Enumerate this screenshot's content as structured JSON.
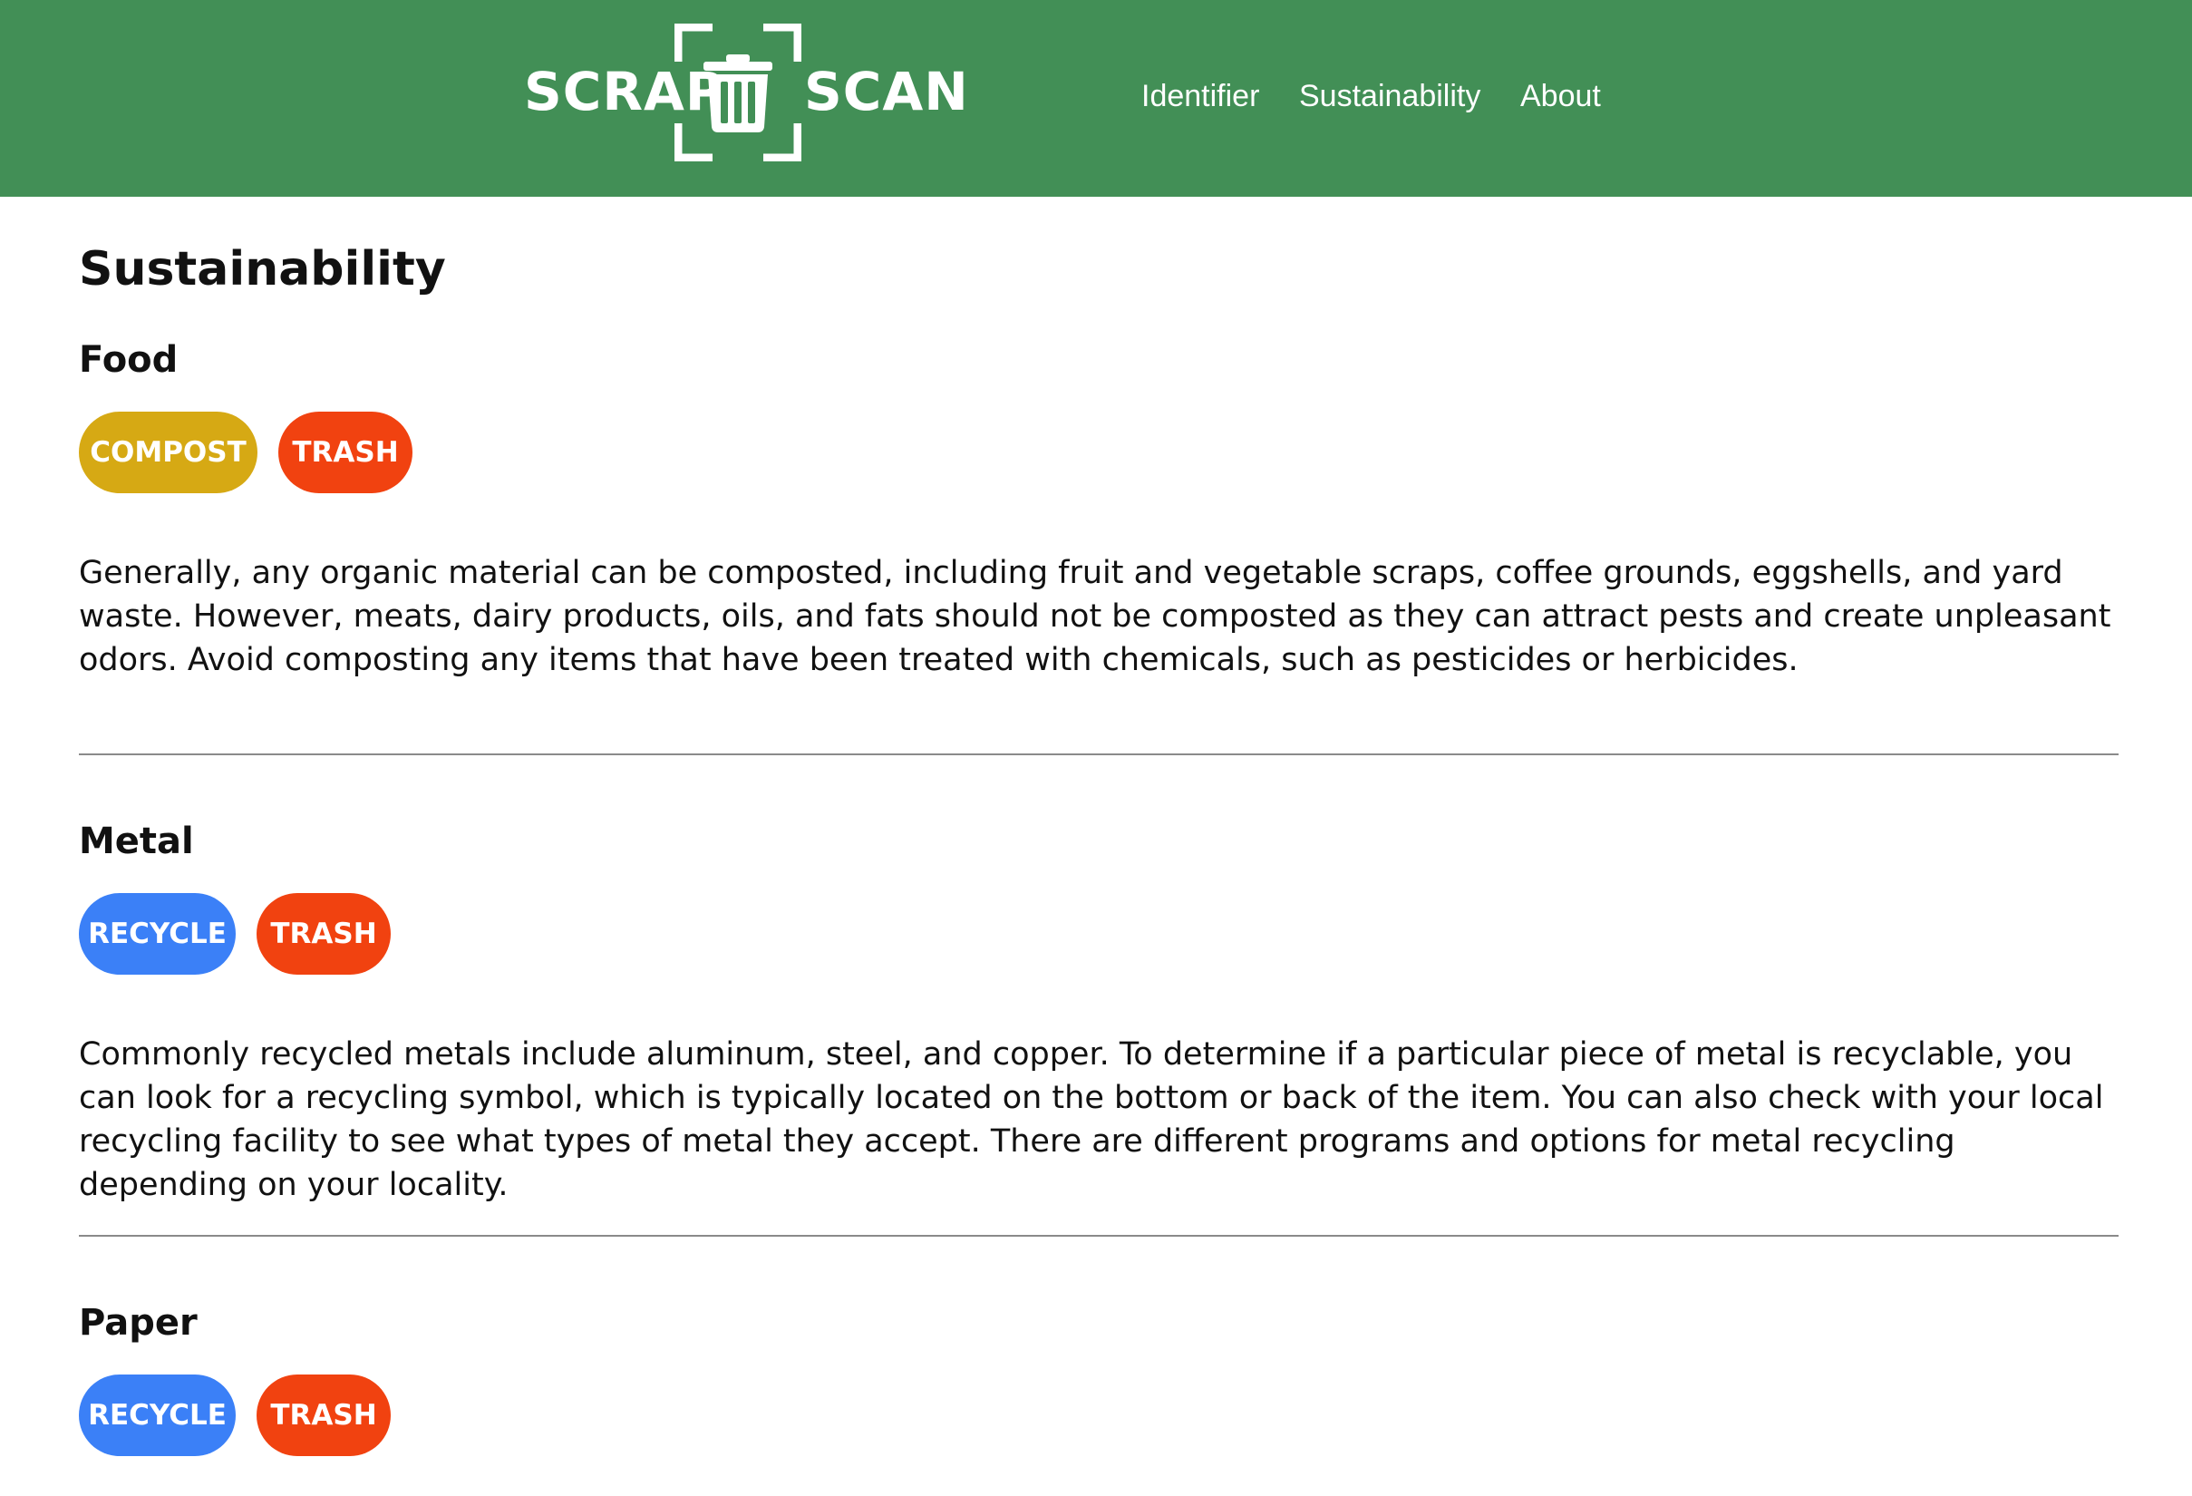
{
  "colors": {
    "header_bg": "#428f56",
    "compost": "#d6a914",
    "trash": "#f14210",
    "recycle": "#3b80f7"
  },
  "header": {
    "logo": {
      "left_word": "SCRAP",
      "right_word": "SCAN",
      "icon": "trash-can-scan-icon"
    },
    "nav": [
      "Identifier",
      "Sustainability",
      "About"
    ]
  },
  "page_title": "Sustainability",
  "sections": [
    {
      "title": "Food",
      "tags": [
        "COMPOST",
        "TRASH"
      ],
      "description": "Generally, any organic material can be composted, including fruit and vegetable scraps, coffee grounds, eggshells, and yard waste. However, meats, dairy products, oils, and fats should not be composted as they can attract pests and create unpleasant odors. Avoid composting any items that have been treated with chemicals, such as pesticides or herbicides."
    },
    {
      "title": "Metal",
      "tags": [
        "RECYCLE",
        "TRASH"
      ],
      "description": "Commonly recycled metals include aluminum, steel, and copper. To determine if a particular piece of metal is recyclable, you can look for a recycling symbol, which is typically located on the bottom or back of the item. You can also check with your local recycling facility to see what types of metal they accept. There are different programs and options for metal recycling depending on your locality."
    },
    {
      "title": "Paper",
      "tags": [
        "RECYCLE",
        "TRASH"
      ]
    }
  ]
}
